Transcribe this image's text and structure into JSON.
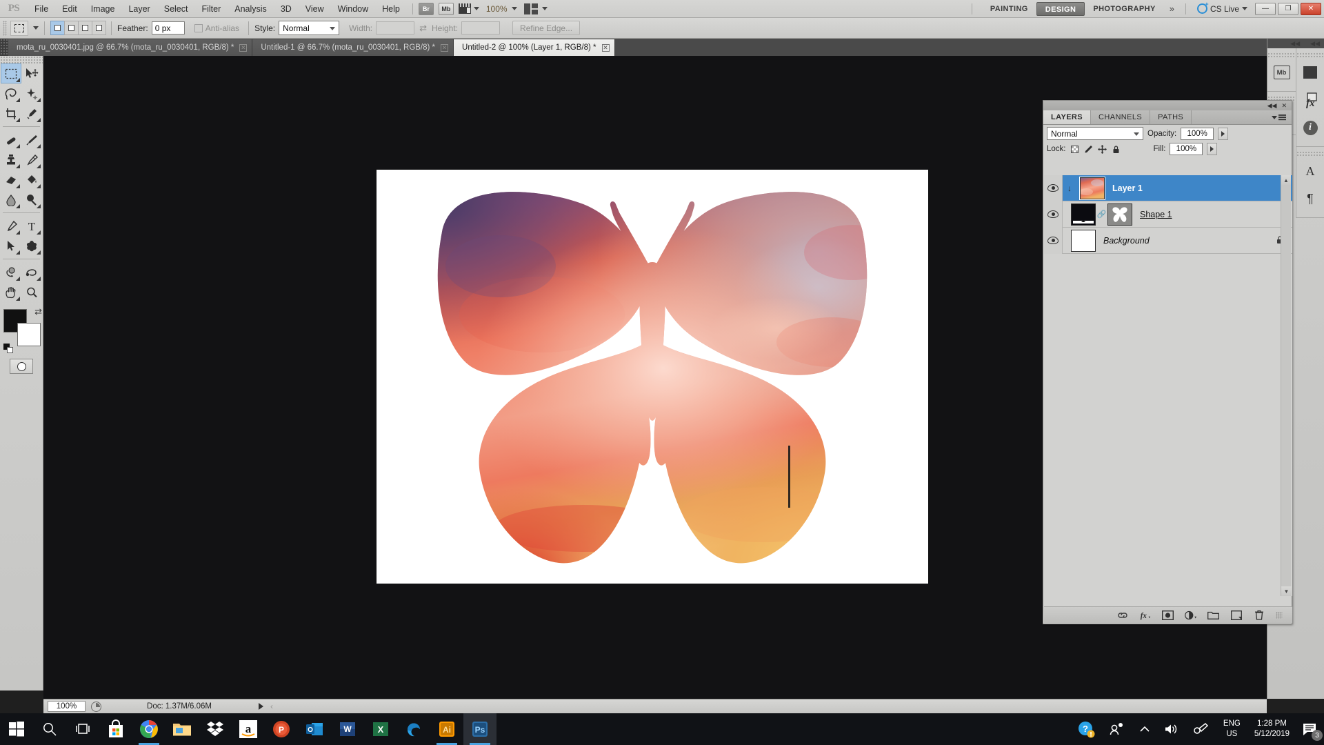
{
  "app": {
    "name": "Adobe Photoshop",
    "logo": "PS"
  },
  "menubar": {
    "items": [
      "File",
      "Edit",
      "Image",
      "Layer",
      "Select",
      "Filter",
      "Analysis",
      "3D",
      "View",
      "Window",
      "Help"
    ],
    "bridge_label": "Br",
    "minibridge_label": "Mb",
    "zoom_value": "100%",
    "workspaces": [
      {
        "label": "PAINTING",
        "active": false
      },
      {
        "label": "DESIGN",
        "active": true
      },
      {
        "label": "PHOTOGRAPHY",
        "active": false
      }
    ],
    "overflow": "»",
    "cslive_label": "CS Live",
    "window_buttons": {
      "minimize": "—",
      "restore": "❐",
      "close": "✕"
    }
  },
  "options_bar": {
    "tool": "rectangular-marquee",
    "feather_label": "Feather:",
    "feather_value": "0 px",
    "antialias_label": "Anti-alias",
    "style_label": "Style:",
    "style_value": "Normal",
    "width_label": "Width:",
    "width_value": "",
    "height_label": "Height:",
    "height_value": "",
    "refine_edge_label": "Refine Edge..."
  },
  "document_tabs": [
    {
      "label": "mota_ru_0030401.jpg @ 66.7% (mota_ru_0030401, RGB/8) *",
      "active": false
    },
    {
      "label": "Untitled-1 @ 66.7% (mota_ru_0030401, RGB/8) *",
      "active": false
    },
    {
      "label": "Untitled-2 @ 100% (Layer 1, RGB/8) *",
      "active": true
    }
  ],
  "toolbox": {
    "tools": [
      {
        "name": "rectangular-marquee",
        "selected": true
      },
      {
        "name": "move",
        "selected": false
      },
      {
        "name": "lasso",
        "selected": false
      },
      {
        "name": "quick-selection",
        "selected": false
      },
      {
        "name": "crop",
        "selected": false
      },
      {
        "name": "eyedropper",
        "selected": false
      },
      {
        "name": "spot-healing-brush",
        "selected": false
      },
      {
        "name": "brush",
        "selected": false
      },
      {
        "name": "clone-stamp",
        "selected": false
      },
      {
        "name": "history-brush",
        "selected": false
      },
      {
        "name": "eraser",
        "selected": false
      },
      {
        "name": "paint-bucket",
        "selected": false
      },
      {
        "name": "blur",
        "selected": false
      },
      {
        "name": "dodge",
        "selected": false
      },
      {
        "name": "pen",
        "selected": false
      },
      {
        "name": "horizontal-type",
        "selected": false
      },
      {
        "name": "path-selection",
        "selected": false
      },
      {
        "name": "custom-shape",
        "selected": false
      },
      {
        "name": "3d-object-rotate",
        "selected": false
      },
      {
        "name": "3d-camera-rotate",
        "selected": false
      },
      {
        "name": "hand",
        "selected": false
      },
      {
        "name": "zoom",
        "selected": false
      }
    ],
    "foreground_color": "#111111",
    "background_color": "#ffffff"
  },
  "canvas": {
    "background_color": "#121214",
    "document_background": "#ffffff",
    "artwork": {
      "name": "butterfly-sunset-sky",
      "description": "Butterfly silhouette filled with a sunset sky photograph",
      "palette": [
        "#4a3f6b",
        "#8a4a6e",
        "#e5614b",
        "#ef7a62",
        "#f2a08d",
        "#f6c9b9",
        "#b9b2c4",
        "#e8a14a",
        "#f3c066",
        "#d8392b"
      ]
    }
  },
  "status_bar": {
    "zoom": "100%",
    "doc_label": "Doc: 1.37M/6.06M"
  },
  "right_rail": {
    "groups": [
      [
        "mini-bridge"
      ],
      [
        "history"
      ],
      [
        "adjustments",
        "styles",
        "info"
      ],
      [
        "character",
        "paragraph"
      ]
    ],
    "mini_bridge_label": "Mb",
    "styles_label": "fx",
    "info_label": "i",
    "character_label": "A",
    "paragraph_label": "¶"
  },
  "layers_panel": {
    "tabs": [
      {
        "label": "LAYERS",
        "active": true
      },
      {
        "label": "CHANNELS",
        "active": false
      },
      {
        "label": "PATHS",
        "active": false
      }
    ],
    "blend_mode": "Normal",
    "opacity_label": "Opacity:",
    "opacity_value": "100%",
    "lock_label": "Lock:",
    "fill_label": "Fill:",
    "fill_value": "100%",
    "lock_buttons": [
      "lock-transparent-pixels",
      "lock-image-pixels",
      "lock-position",
      "lock-all"
    ],
    "layers": [
      {
        "name": "Layer 1",
        "visible": true,
        "selected": true,
        "style": "bold",
        "clipped": true,
        "thumb": "butterfly-sky"
      },
      {
        "name": "Shape 1",
        "visible": true,
        "selected": false,
        "style": "underline",
        "thumb": "black-fill",
        "mask": "butterfly-vector-mask"
      },
      {
        "name": "Background",
        "visible": true,
        "selected": false,
        "style": "italic",
        "thumb": "white",
        "locked": true
      }
    ],
    "footer_buttons": [
      "link-layers",
      "add-layer-style",
      "add-layer-mask",
      "new-adjustment-layer",
      "new-group",
      "new-layer",
      "delete-layer"
    ]
  },
  "taskbar": {
    "items": [
      {
        "name": "start",
        "label": ""
      },
      {
        "name": "search",
        "label": ""
      },
      {
        "name": "task-view",
        "label": ""
      },
      {
        "name": "microsoft-store",
        "label": ""
      },
      {
        "name": "google-chrome",
        "label": "",
        "running": true
      },
      {
        "name": "file-explorer",
        "label": ""
      },
      {
        "name": "dropbox",
        "label": ""
      },
      {
        "name": "amazon",
        "label": "a"
      },
      {
        "name": "powerpoint",
        "label": "P"
      },
      {
        "name": "outlook",
        "label": "O"
      },
      {
        "name": "word",
        "label": "W"
      },
      {
        "name": "excel",
        "label": "X"
      },
      {
        "name": "microsoft-edge",
        "label": "e"
      },
      {
        "name": "adobe-illustrator",
        "label": "Ai",
        "running": true
      },
      {
        "name": "adobe-photoshop",
        "label": "Ps",
        "running": true,
        "active": true
      }
    ],
    "tray": {
      "language_line1": "ENG",
      "language_line2": "US",
      "time": "1:28 PM",
      "date": "5/12/2019",
      "notification_count": "3"
    }
  }
}
